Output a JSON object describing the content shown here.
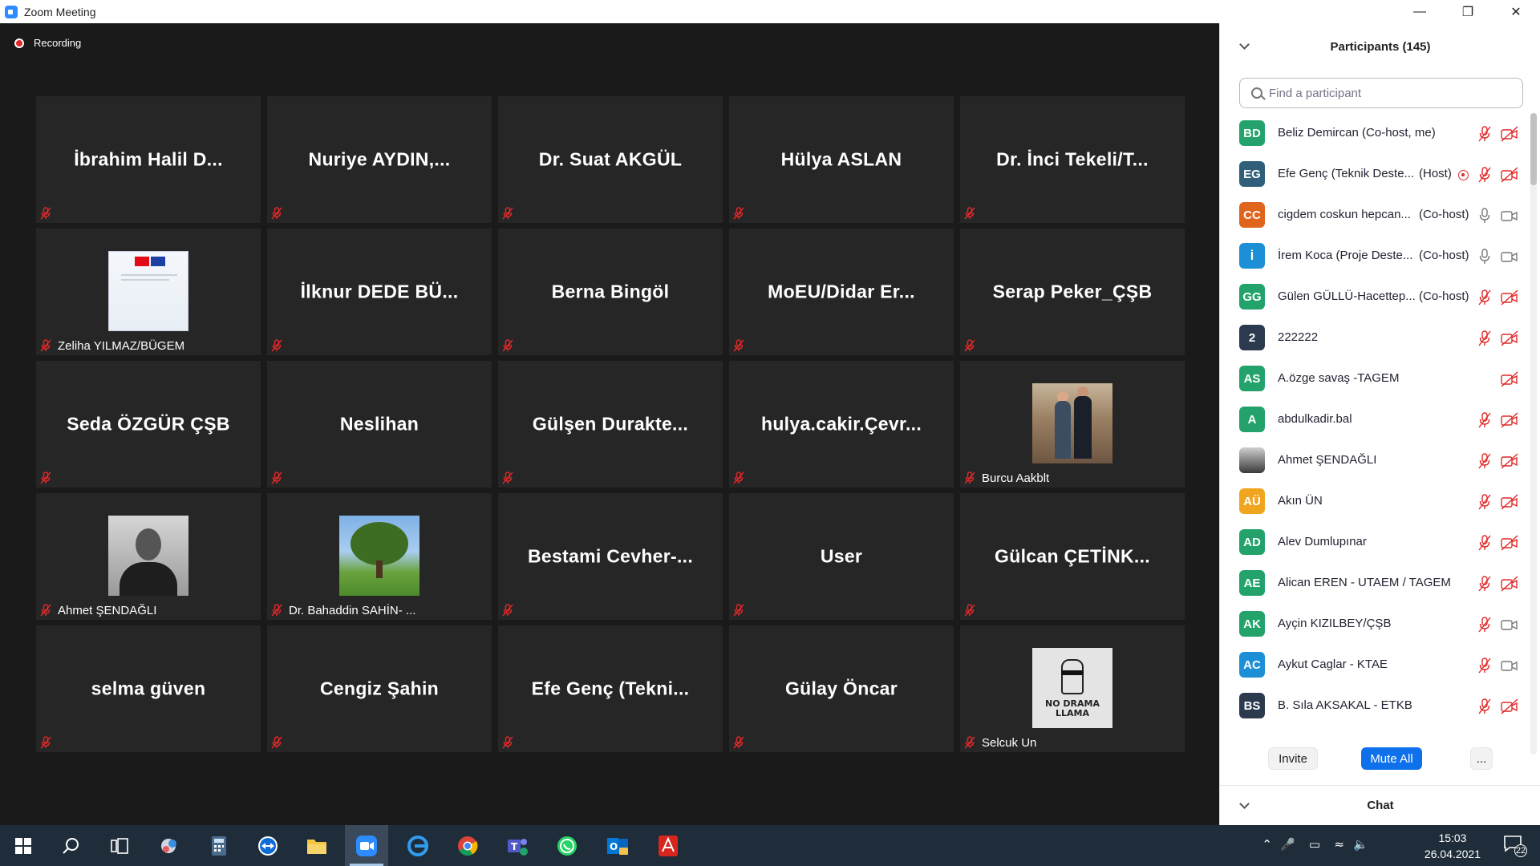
{
  "window": {
    "title": "Zoom Meeting"
  },
  "meeting": {
    "recording_label": "Recording",
    "tiles": [
      {
        "name": "İbrahim  Halil  D...",
        "label": ""
      },
      {
        "name": "Nuriye  AYDIN,...",
        "label": ""
      },
      {
        "name": "Dr. Suat AKGÜL",
        "label": ""
      },
      {
        "name": "Hülya ASLAN",
        "label": ""
      },
      {
        "name": "Dr.  İnci Tekeli/T...",
        "label": ""
      },
      {
        "name": "",
        "label": "Zeliha YILMAZ/BÜGEM",
        "photo": "flag-document"
      },
      {
        "name": "İlknur  DEDE BÜ...",
        "label": ""
      },
      {
        "name": "Berna Bingöl",
        "label": ""
      },
      {
        "name": "MoEU/Didar  Er...",
        "label": ""
      },
      {
        "name": "Serap Peker_ÇŞB",
        "label": ""
      },
      {
        "name": "Seda ÖZGÜR ÇŞB",
        "label": ""
      },
      {
        "name": "Neslihan",
        "label": ""
      },
      {
        "name": "Gülşen  Durakte...",
        "label": ""
      },
      {
        "name": "hulya.cakir.Çevr...",
        "label": ""
      },
      {
        "name": "",
        "label": "Burcu Aakblt",
        "photo": "couple"
      },
      {
        "name": "",
        "label": "Ahmet ŞENDAĞLI",
        "photo": "man-portrait"
      },
      {
        "name": "",
        "label": "Dr. Bahaddin SAHİN- ...",
        "photo": "tree"
      },
      {
        "name": "Bestami  Cevher-...",
        "label": ""
      },
      {
        "name": "User",
        "label": ""
      },
      {
        "name": "Gülcan  ÇETİNK...",
        "label": ""
      },
      {
        "name": "selma güven",
        "label": ""
      },
      {
        "name": "Cengiz Şahin",
        "label": ""
      },
      {
        "name": "Efe  Genç  (Tekni...",
        "label": ""
      },
      {
        "name": "Gülay Öncar",
        "label": ""
      },
      {
        "name": "",
        "label": "Selcuk Un",
        "photo": "no-drama-llama",
        "photo_text": "NO DRAMA LLAMA"
      }
    ]
  },
  "participants": {
    "title": "Participants (145)",
    "search_placeholder": "Find a participant",
    "list": [
      {
        "initials": "BD",
        "color": "#23a36b",
        "name": "Beliz Demircan (Co-host, me)",
        "role": "",
        "recording": false,
        "mic": "muted",
        "cam": "off"
      },
      {
        "initials": "EG",
        "color": "#2f5f79",
        "name": "Efe Genç (Teknik Deste...",
        "role": "(Host)",
        "recording": true,
        "mic": "muted",
        "cam": "off"
      },
      {
        "initials": "CC",
        "color": "#e0651c",
        "name": "cigdem coskun hepcan...",
        "role": "(Co-host)",
        "recording": false,
        "mic": "on",
        "cam": "on"
      },
      {
        "initials": "İ",
        "color": "#1d8fd6",
        "name": "İrem Koca (Proje Deste...",
        "role": "(Co-host)",
        "recording": false,
        "mic": "on",
        "cam": "on"
      },
      {
        "initials": "GG",
        "color": "#23a36b",
        "name": "Gülen GÜLLÜ-Hacettep...",
        "role": "(Co-host)",
        "recording": false,
        "mic": "muted",
        "cam": "off"
      },
      {
        "initials": "2",
        "color": "#2b3a4e",
        "name": "222222",
        "role": "",
        "recording": false,
        "mic": "muted",
        "cam": "off"
      },
      {
        "initials": "AS",
        "color": "#23a36b",
        "name": "A.özge savaş -TAGEM",
        "role": "",
        "recording": false,
        "mic": "none",
        "cam": "off"
      },
      {
        "initials": "A",
        "color": "#23a36b",
        "name": "abdulkadir.bal",
        "role": "",
        "recording": false,
        "mic": "muted",
        "cam": "off"
      },
      {
        "initials": "",
        "color": "#555555",
        "name": "Ahmet ŞENDAĞLI",
        "role": "",
        "recording": false,
        "mic": "muted",
        "cam": "off",
        "photo": true
      },
      {
        "initials": "AÜ",
        "color": "#f0a51e",
        "name": "Akın ÜN",
        "role": "",
        "recording": false,
        "mic": "muted",
        "cam": "off"
      },
      {
        "initials": "AD",
        "color": "#23a36b",
        "name": "Alev Dumlupınar",
        "role": "",
        "recording": false,
        "mic": "muted",
        "cam": "off"
      },
      {
        "initials": "AE",
        "color": "#23a36b",
        "name": "Alican EREN - UTAEM / TAGEM",
        "role": "",
        "recording": false,
        "mic": "muted",
        "cam": "off"
      },
      {
        "initials": "AK",
        "color": "#23a36b",
        "name": "Ayçin KIZILBEY/ÇŞB",
        "role": "",
        "recording": false,
        "mic": "muted",
        "cam": "on"
      },
      {
        "initials": "AC",
        "color": "#1d8fd6",
        "name": "Aykut Caglar - KTAE",
        "role": "",
        "recording": false,
        "mic": "muted",
        "cam": "on"
      },
      {
        "initials": "BS",
        "color": "#2b3a4e",
        "name": "B. Sıla AKSAKAL - ETKB",
        "role": "",
        "recording": false,
        "mic": "muted",
        "cam": "off"
      }
    ],
    "buttons": {
      "invite": "Invite",
      "mute_all": "Mute All",
      "more": "..."
    },
    "chat_label": "Chat"
  },
  "taskbar": {
    "apps": [
      "start-icon",
      "search-icon",
      "task-view-icon",
      "weather-app-icon",
      "calculator-icon",
      "teamviewer-icon",
      "file-explorer-icon",
      "zoom-icon",
      "edge-icon",
      "chrome-icon",
      "teams-icon",
      "whatsapp-icon",
      "outlook-icon",
      "acrobat-icon"
    ],
    "time": "15:03",
    "date": "26.04.2021",
    "notifications": "22"
  },
  "colors": {
    "accent": "#0e71eb",
    "muted_red": "#e02828",
    "tile_bg": "#262626"
  }
}
